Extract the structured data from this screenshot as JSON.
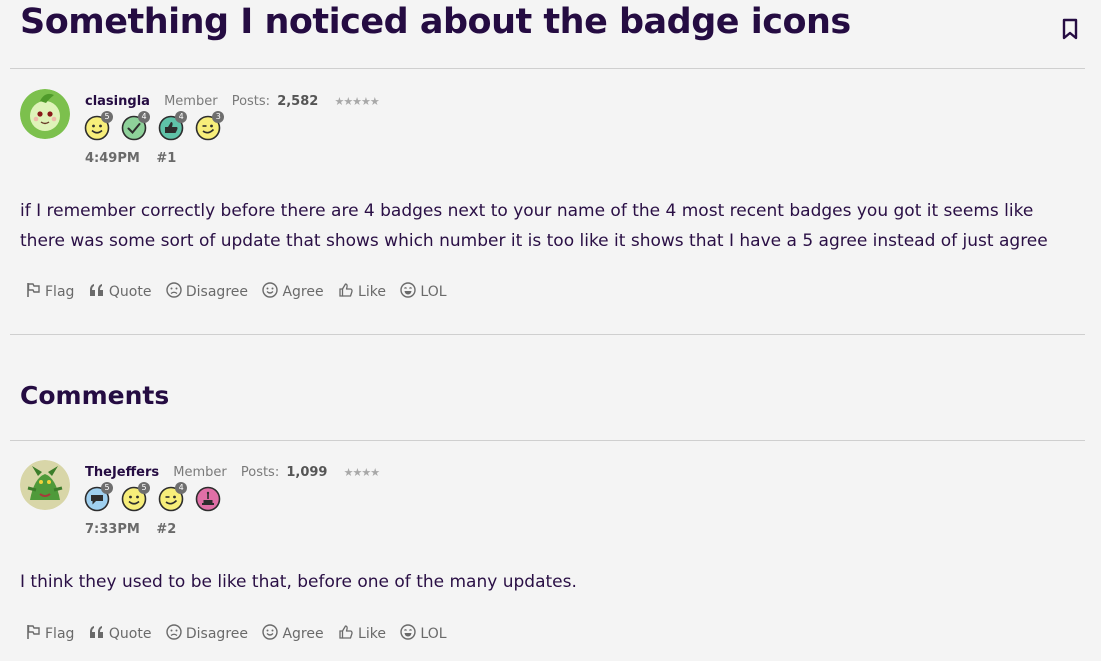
{
  "thread": {
    "title": "Something I noticed about the badge icons"
  },
  "posts": [
    {
      "username": "clasingla",
      "role": "Member",
      "posts_label": "Posts:",
      "posts_count": "2,582",
      "stars": "★★★★★",
      "badges": [
        {
          "icon": "smile-badge-icon",
          "level": "5"
        },
        {
          "icon": "check-badge-icon",
          "level": "4"
        },
        {
          "icon": "thumbs-up-badge-icon",
          "level": "4"
        },
        {
          "icon": "wink-badge-icon",
          "level": "3"
        }
      ],
      "time": "4:49PM",
      "number": "#1",
      "body_line1": "if I remember correctly before there are 4 badges next to your name of the 4 most recent badges you got it seems like",
      "body_line2": "there was some sort of update that shows which number it is too like it shows that I have a 5 agree instead of just agree"
    },
    {
      "username": "TheJeffers",
      "role": "Member",
      "posts_label": "Posts:",
      "posts_count": "1,099",
      "stars": "★★★★",
      "badges": [
        {
          "icon": "speech-bubble-badge-icon",
          "level": "5"
        },
        {
          "icon": "smile-badge-icon",
          "level": "5"
        },
        {
          "icon": "wink-badge-icon",
          "level": "4"
        },
        {
          "icon": "birthday-cake-badge-icon",
          "level": ""
        }
      ],
      "time": "7:33PM",
      "number": "#2",
      "body_line1": "I think they used to be like that, before one of the many updates."
    }
  ],
  "actions": {
    "flag": "Flag",
    "quote": "Quote",
    "disagree": "Disagree",
    "agree": "Agree",
    "like": "Like",
    "lol": "LOL"
  },
  "comments_heading": "Comments",
  "colors": {
    "title": "#250c42",
    "text": "#2a0f45",
    "muted": "#6a6a6a",
    "background": "#f4f4f4",
    "divider": "#cfcfcf"
  }
}
